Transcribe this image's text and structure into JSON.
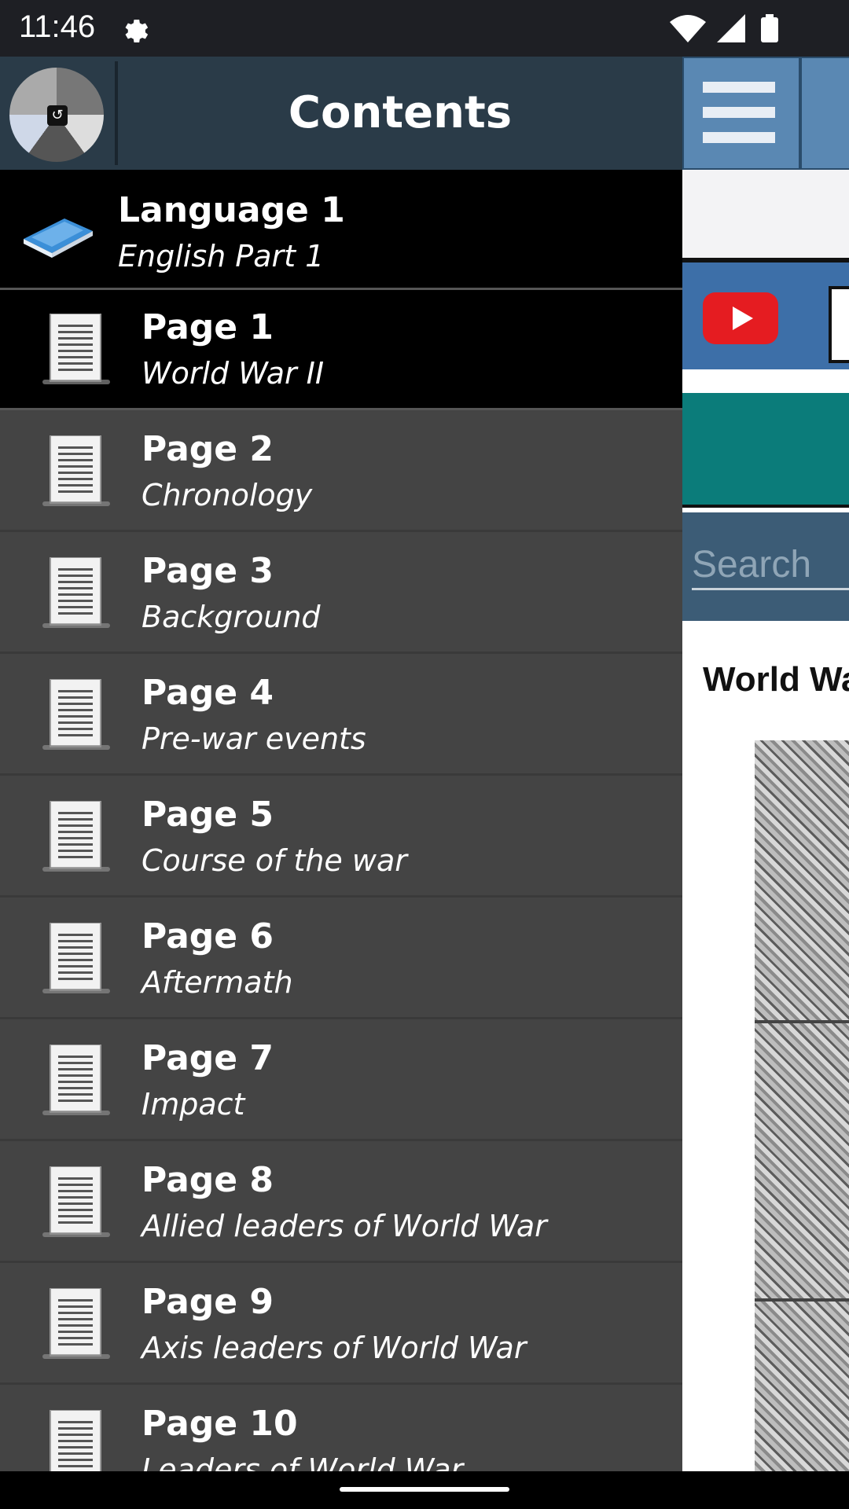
{
  "status": {
    "time": "11:46"
  },
  "drawer": {
    "title": "Contents",
    "language": {
      "title": "Language 1",
      "subtitle": "English Part 1"
    },
    "items": [
      {
        "title": "Page 1",
        "subtitle": "World War II",
        "active": true
      },
      {
        "title": "Page 2",
        "subtitle": "Chronology"
      },
      {
        "title": "Page 3",
        "subtitle": "Background"
      },
      {
        "title": "Page 4",
        "subtitle": "Pre-war events"
      },
      {
        "title": "Page 5",
        "subtitle": "Course of the war"
      },
      {
        "title": "Page 6",
        "subtitle": "Aftermath"
      },
      {
        "title": "Page 7",
        "subtitle": "Impact"
      },
      {
        "title": "Page 8",
        "subtitle": "Allied leaders of World War"
      },
      {
        "title": "Page 9",
        "subtitle": "Axis leaders of World War"
      },
      {
        "title": "Page 10",
        "subtitle": "Leaders of World War"
      }
    ]
  },
  "main": {
    "search_placeholder": "Search",
    "article_title": "World Wa"
  },
  "icons": {
    "status": [
      "gear-icon",
      "wifi-icon",
      "signal-icon",
      "battery-icon"
    ],
    "drawer": [
      "avatar",
      "book-icon",
      "document-icon"
    ],
    "main": [
      "menu-icon",
      "youtube-icon"
    ]
  },
  "colors": {
    "drawer_bg": "#444444",
    "active_item_bg": "#000000",
    "header_bg": "#2a3b48",
    "main_header_bg": "#5a88b3",
    "youtube_red": "#e51c21",
    "teal": "#0b7c7a"
  }
}
